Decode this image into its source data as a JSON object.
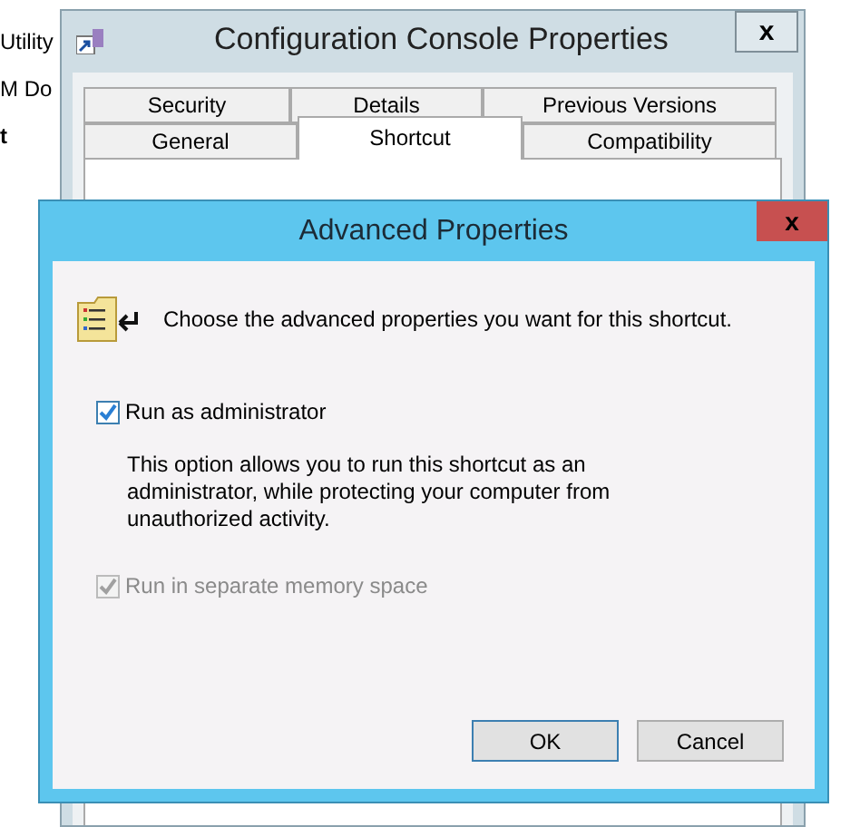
{
  "background_items": [
    {
      "label": "Utility",
      "bold": false
    },
    {
      "label": "M Do",
      "bold": false
    },
    {
      "label": "t",
      "bold": true
    }
  ],
  "properties_window": {
    "title": "Configuration Console Properties",
    "close": "x",
    "tab_rows": [
      [
        {
          "label": "Security",
          "selected": false
        },
        {
          "label": "Details",
          "selected": false
        },
        {
          "label": "Previous Versions",
          "selected": false
        }
      ],
      [
        {
          "label": "General",
          "selected": false
        },
        {
          "label": "Shortcut",
          "selected": true
        },
        {
          "label": "Compatibility",
          "selected": false
        }
      ]
    ]
  },
  "dialog": {
    "title": "Advanced Properties",
    "close": "x",
    "intro": "Choose the advanced properties you want for this shortcut.",
    "options": [
      {
        "label": "Run as administrator",
        "checked": true,
        "disabled": false,
        "description": "This option allows you to run this shortcut as an administrator, while protecting your computer from unauthorized activity."
      },
      {
        "label": "Run in separate memory space",
        "checked": true,
        "disabled": true
      }
    ],
    "buttons": [
      "OK",
      "Cancel"
    ]
  }
}
